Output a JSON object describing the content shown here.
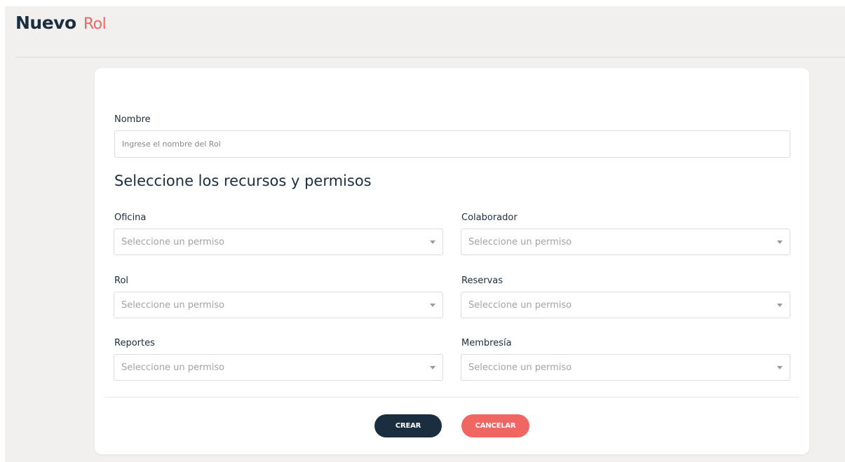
{
  "header": {
    "title_main": "Nuevo",
    "title_accent": "Rol"
  },
  "form": {
    "name_label": "Nombre",
    "name_placeholder": "Ingrese el nombre del Rol",
    "name_value": "",
    "section_heading": "Seleccione los recursos y permisos",
    "resources": [
      {
        "label": "Oficina",
        "placeholder": "Seleccione un permiso"
      },
      {
        "label": "Colaborador",
        "placeholder": "Seleccione un permiso"
      },
      {
        "label": "Rol",
        "placeholder": "Seleccione un permiso"
      },
      {
        "label": "Reservas",
        "placeholder": "Seleccione un permiso"
      },
      {
        "label": "Reportes",
        "placeholder": "Seleccione un permiso"
      },
      {
        "label": "Membresía",
        "placeholder": "Seleccione un permiso"
      }
    ]
  },
  "actions": {
    "create_label": "CREAR",
    "cancel_label": "CANCELAR"
  },
  "colors": {
    "primary": "#1b2e40",
    "accent": "#ef6663",
    "background": "#f1f0ee"
  },
  "icons": [
    "chevron-down-icon"
  ]
}
